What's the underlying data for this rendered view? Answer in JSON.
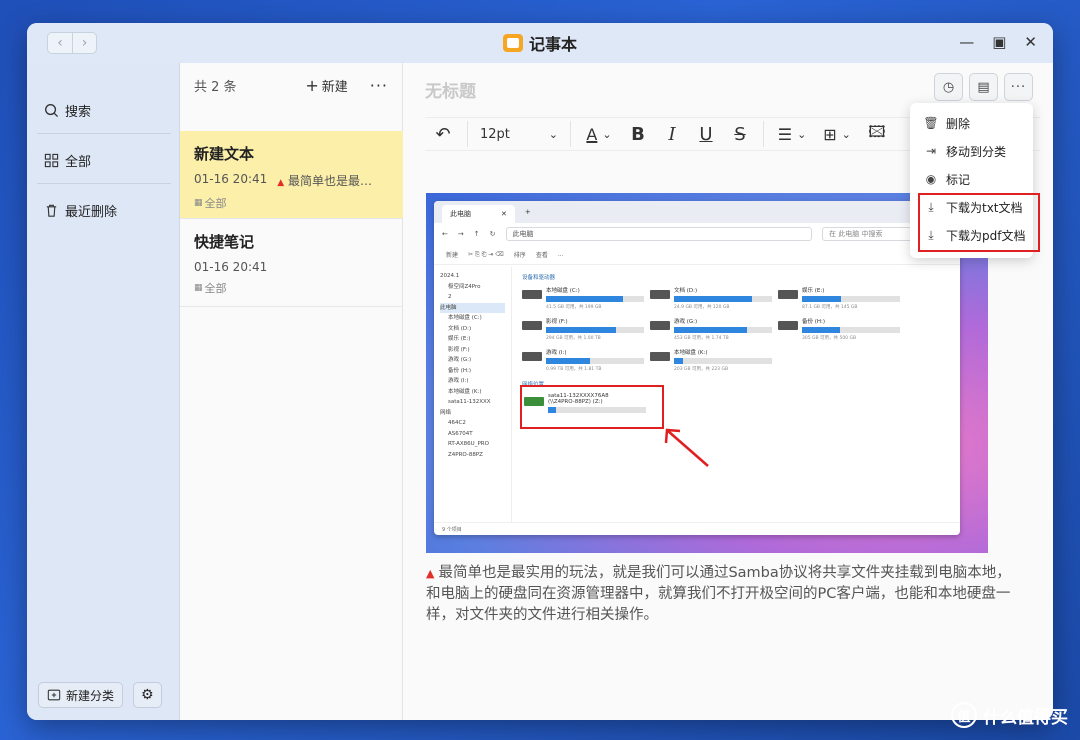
{
  "window": {
    "title": "记事本"
  },
  "sidebar": {
    "items": [
      {
        "label": "搜索",
        "icon": "search-icon"
      },
      {
        "label": "全部",
        "icon": "grid-icon"
      },
      {
        "label": "最近删除",
        "icon": "trash-icon"
      }
    ],
    "new_category": "新建分类"
  },
  "list": {
    "count": "共 2 条",
    "new_label": "新建",
    "notes": [
      {
        "title": "新建文本",
        "time": "01-16 20:41",
        "preview": "最简单也是最…",
        "category": "全部"
      },
      {
        "title": "快捷笔记",
        "time": "01-16 20:41",
        "preview": "",
        "category": "全部"
      }
    ]
  },
  "editor": {
    "title": "无标题",
    "font_size": "12pt",
    "body": "最简单也是最实用的玩法，就是我们可以通过Samba协议将共享文件夹挂载到电脑本地，和电脑上的硬盘同在资源管理器中，就算我们不打开极空间的PC客户端，也能和本地硬盘一样，对文件夹的文件进行相关操作。"
  },
  "menu": {
    "items": [
      {
        "label": "删除",
        "icon": "trash-icon"
      },
      {
        "label": "移动到分类",
        "icon": "move-icon"
      },
      {
        "label": "标记",
        "icon": "mark-icon"
      },
      {
        "label": "下载为txt文档",
        "icon": "download-icon"
      },
      {
        "label": "下载为pdf文档",
        "icon": "download-icon"
      }
    ]
  },
  "explorer": {
    "tab": "此电脑",
    "path": "此电脑",
    "search": "在 此电脑 中搜索",
    "cmd": [
      "新建",
      "排序",
      "查看",
      "..."
    ],
    "nav": [
      "2024.1",
      "极空间Z4Pro",
      "2",
      "此电脑",
      "本地磁盘 (C:)",
      "文档 (D:)",
      "娱乐 (E:)",
      "影视 (F:)",
      "游戏 (G:)",
      "备份 (H:)",
      "游戏 (I:)",
      "本地磁盘 (K:)",
      "sata11-132XXX",
      "网络",
      "464C2",
      "AS6704T",
      "RT-AX86U_PRO",
      "Z4PRO-88PZ"
    ],
    "section_devices": "设备和驱动器",
    "section_network": "网络位置",
    "drives": [
      {
        "name": "本地磁盘 (C:)",
        "sub": "41.5 GB 可用，共 199 GB",
        "fill": 0.79
      },
      {
        "name": "文档 (D:)",
        "sub": "24.9 GB 可用，共 120 GB",
        "fill": 0.8
      },
      {
        "name": "娱乐 (E:)",
        "sub": "87.1 GB 可用，共 145 GB",
        "fill": 0.4
      },
      {
        "name": "影视 (F:)",
        "sub": "294 GB 可用，共 1.00 TB",
        "fill": 0.71
      },
      {
        "name": "游戏 (G:)",
        "sub": "453 GB 可用，共 1.74 TB",
        "fill": 0.74
      },
      {
        "name": "备份 (H:)",
        "sub": "305 GB 可用，共 500 GB",
        "fill": 0.39
      },
      {
        "name": "游戏 (I:)",
        "sub": "0.99 TB 可用，共 1.81 TB",
        "fill": 0.45
      },
      {
        "name": "本地磁盘 (K:)",
        "sub": "203 GB 可用，共 223 GB",
        "fill": 0.09
      }
    ],
    "network_drive": {
      "name": "sata11-132XXXX76A8",
      "sub": "(\\\\Z4PRO-88PZ) (Z:)",
      "fill": 0.08
    },
    "status": "9 个项目"
  },
  "watermark": "什么值得买"
}
